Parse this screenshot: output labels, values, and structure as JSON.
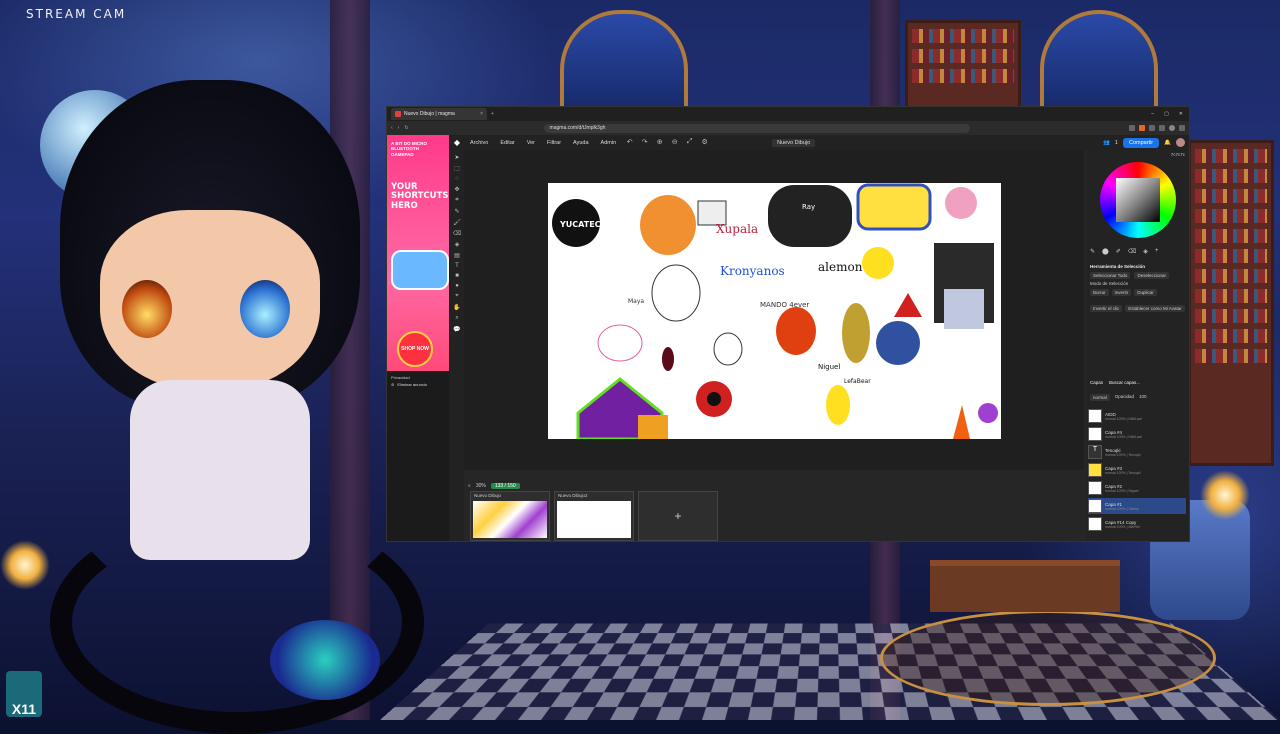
{
  "stream": {
    "cam_label": "STREAM CAM",
    "badge": "X11"
  },
  "browser": {
    "tab_title": "Nuevo Dibujo | magma",
    "url": "magma.com/d/tJmplk3gh",
    "window_controls": [
      "–",
      "▢",
      "✕"
    ]
  },
  "ad": {
    "header": "A BIT DO MICRO BLUETOOTH GAMEPAD",
    "tagline": "YOUR SHORTCUTS HERO",
    "shop_label": "SHOP NOW",
    "privacy_label": "Privacidad",
    "remove_label": "Eliminar anuncio"
  },
  "app": {
    "menu": [
      "Archivo",
      "Editar",
      "Ver",
      "Filtrar",
      "Ayuda",
      "Admin"
    ],
    "document_name": "Nuevo Dibujo",
    "share_label": "Compartir",
    "user_count": "1",
    "zoom": "30%",
    "layer_counter": "133 / 150"
  },
  "drawing_texts": [
    "YUCATECA",
    "Xupala",
    "Kronyanos",
    "alemon",
    "Niguel",
    "LefaBear",
    "MANDO 4ever",
    "Maya",
    "Ray"
  ],
  "panel": {
    "hex": "7c7c7c",
    "selection_title": "Herramienta de Selección",
    "select_all": "Seleccionar Todo",
    "deselect": "Deseleccionar",
    "mode_label": "Modo de Selección",
    "buttons": [
      "Borrar",
      "Invertir",
      "Duplicar"
    ],
    "transform_btns": [
      "Invertir el clic",
      "Establecer como Mi Avatar"
    ],
    "layers_title": "Capas",
    "search_placeholder": "Buscar capas...",
    "blend": "normal",
    "opacity_label": "Opacidad",
    "opacity_val": "100"
  },
  "layers": [
    {
      "name": "AIDD",
      "sub": "normal 100% | KiiitiLaal"
    },
    {
      "name": "Capa #4",
      "sub": "normal 100% | KiiitiLaal"
    },
    {
      "name": "Tenoqki",
      "sub": "normal 100% | Tenoqki"
    },
    {
      "name": "Capa #3",
      "sub": "normal 100% | Tenoqki"
    },
    {
      "name": "Capa #2",
      "sub": "normal 100% | Niguel"
    },
    {
      "name": "Capa #1",
      "sub": "normal 100% | Valeny"
    },
    {
      "name": "Capa #14 Copy",
      "sub": "normal 100% | MerRel"
    }
  ],
  "thumbnails": [
    {
      "label": "Nuevo Dibujo"
    },
    {
      "label": "Nuevo Dibujo2"
    }
  ],
  "colors": {
    "accent": "#1a73e8",
    "ad_pink": "#ff3a8a",
    "zoom_green": "#2a8a4a"
  }
}
